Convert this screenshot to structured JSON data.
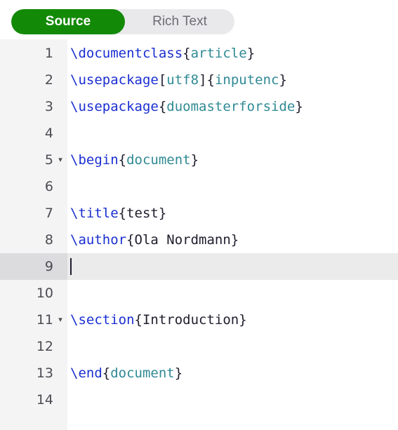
{
  "toolbar": {
    "source_label": "Source",
    "rich_text_label": "Rich Text"
  },
  "editor": {
    "lines": [
      {
        "num": "1",
        "fold": "",
        "tokens": [
          {
            "t": "cmd",
            "v": "\\documentclass"
          },
          {
            "t": "txt",
            "v": "{"
          },
          {
            "t": "arg",
            "v": "article"
          },
          {
            "t": "txt",
            "v": "}"
          }
        ]
      },
      {
        "num": "2",
        "fold": "",
        "tokens": [
          {
            "t": "cmd",
            "v": "\\usepackage"
          },
          {
            "t": "txt",
            "v": "["
          },
          {
            "t": "arg",
            "v": "utf8"
          },
          {
            "t": "txt",
            "v": "]{"
          },
          {
            "t": "arg",
            "v": "inputenc"
          },
          {
            "t": "txt",
            "v": "}"
          }
        ]
      },
      {
        "num": "3",
        "fold": "",
        "tokens": [
          {
            "t": "cmd",
            "v": "\\usepackage"
          },
          {
            "t": "txt",
            "v": "{"
          },
          {
            "t": "arg",
            "v": "duomasterforside"
          },
          {
            "t": "txt",
            "v": "}"
          }
        ]
      },
      {
        "num": "4",
        "fold": "",
        "tokens": []
      },
      {
        "num": "5",
        "fold": "▾",
        "tokens": [
          {
            "t": "cmd",
            "v": "\\begin"
          },
          {
            "t": "txt",
            "v": "{"
          },
          {
            "t": "arg",
            "v": "document"
          },
          {
            "t": "txt",
            "v": "}"
          }
        ]
      },
      {
        "num": "6",
        "fold": "",
        "tokens": []
      },
      {
        "num": "7",
        "fold": "",
        "tokens": [
          {
            "t": "cmd",
            "v": "\\title"
          },
          {
            "t": "txt",
            "v": "{test}"
          }
        ]
      },
      {
        "num": "8",
        "fold": "",
        "tokens": [
          {
            "t": "cmd",
            "v": "\\author"
          },
          {
            "t": "txt",
            "v": "{Ola Nordmann}"
          }
        ]
      },
      {
        "num": "9",
        "fold": "",
        "tokens": [],
        "active": true
      },
      {
        "num": "10",
        "fold": "",
        "tokens": []
      },
      {
        "num": "11",
        "fold": "▾",
        "tokens": [
          {
            "t": "cmd",
            "v": "\\section"
          },
          {
            "t": "txt",
            "v": "{Introduction}"
          }
        ]
      },
      {
        "num": "12",
        "fold": "",
        "tokens": []
      },
      {
        "num": "13",
        "fold": "",
        "tokens": [
          {
            "t": "cmd",
            "v": "\\end"
          },
          {
            "t": "txt",
            "v": "{"
          },
          {
            "t": "arg",
            "v": "document"
          },
          {
            "t": "txt",
            "v": "}"
          }
        ]
      },
      {
        "num": "14",
        "fold": "",
        "tokens": []
      }
    ]
  },
  "colors": {
    "accent": "#138a07",
    "command": "#1b2fd1",
    "argument": "#2f8a94",
    "text": "#1e1e2e"
  }
}
